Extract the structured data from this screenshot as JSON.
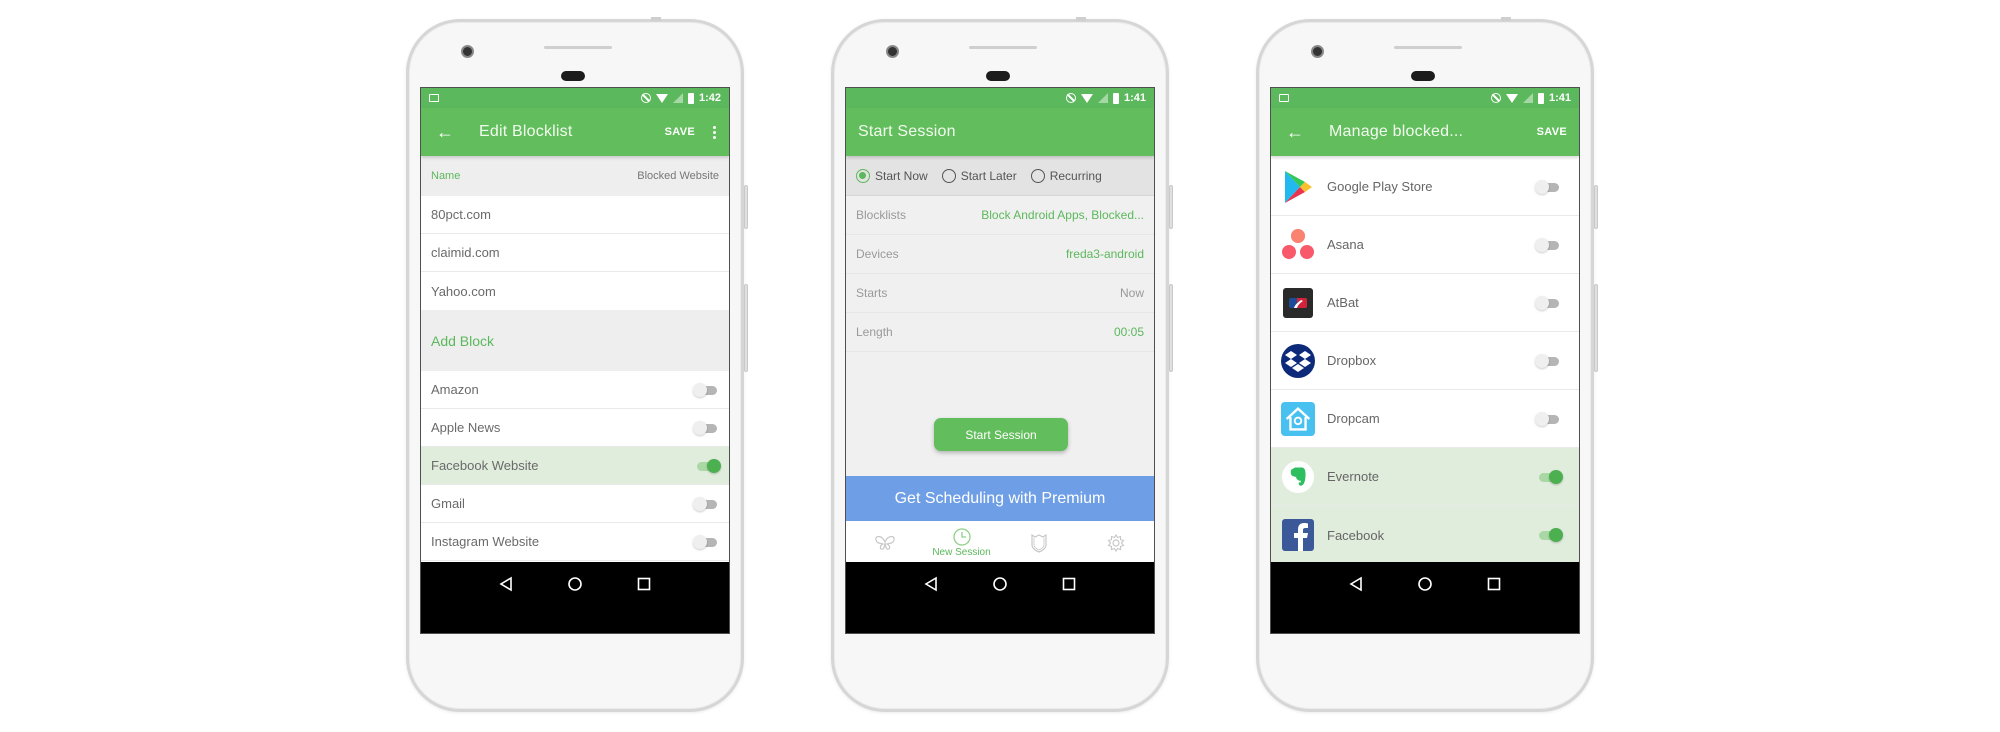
{
  "colors": {
    "brand_green": "#62bd5c",
    "status_green": "#5cb85c",
    "premium_blue": "#6d9ee6",
    "active_row": "#e0ecdc",
    "toggle_on": "#4caf50"
  },
  "phones": [
    {
      "status": {
        "time": "1:42"
      },
      "toolbar": {
        "title": "Edit Blocklist",
        "save_label": "SAVE"
      },
      "name_row": {
        "label": "Name",
        "value": "Blocked Website"
      },
      "sites": [
        "80pct.com",
        "claimid.com",
        "Yahoo.com"
      ],
      "add_block_label": "Add Block",
      "apps": [
        {
          "label": "Amazon",
          "enabled": false
        },
        {
          "label": "Apple News",
          "enabled": false
        },
        {
          "label": "Facebook Website",
          "enabled": true
        },
        {
          "label": "Gmail",
          "enabled": false
        },
        {
          "label": "Instagram Website",
          "enabled": false
        }
      ]
    },
    {
      "status": {
        "time": "1:41"
      },
      "toolbar": {
        "title": "Start Session"
      },
      "radio_options": [
        {
          "label": "Start Now",
          "checked": true
        },
        {
          "label": "Start Later",
          "checked": false
        },
        {
          "label": "Recurring",
          "checked": false
        }
      ],
      "details": [
        {
          "label": "Blocklists",
          "value": "Block Android Apps, Blocked..."
        },
        {
          "label": "Devices",
          "value": "freda3-android"
        },
        {
          "label": "Starts",
          "value": "Now"
        },
        {
          "label": "Length",
          "value": "00:05"
        }
      ],
      "start_button": "Start Session",
      "premium_banner": "Get Scheduling with Premium",
      "tabs": [
        {
          "icon": "butterfly-icon",
          "label": ""
        },
        {
          "icon": "clock-icon",
          "label": "New Session",
          "active": true
        },
        {
          "icon": "shield-icon",
          "label": ""
        },
        {
          "icon": "gear-icon",
          "label": ""
        }
      ]
    },
    {
      "status": {
        "time": "1:41"
      },
      "toolbar": {
        "title": "Manage blocked...",
        "save_label": "SAVE"
      },
      "apps": [
        {
          "label": "Google Play Store",
          "icon": "google-play-icon",
          "enabled": false
        },
        {
          "label": "Asana",
          "icon": "asana-icon",
          "enabled": false
        },
        {
          "label": "AtBat",
          "icon": "mlb-atbat-icon",
          "enabled": false
        },
        {
          "label": "Dropbox",
          "icon": "dropbox-icon",
          "enabled": false
        },
        {
          "label": "Dropcam",
          "icon": "dropcam-icon",
          "enabled": false
        },
        {
          "label": "Evernote",
          "icon": "evernote-icon",
          "enabled": true
        },
        {
          "label": "Facebook",
          "icon": "facebook-icon",
          "enabled": true
        }
      ]
    }
  ]
}
